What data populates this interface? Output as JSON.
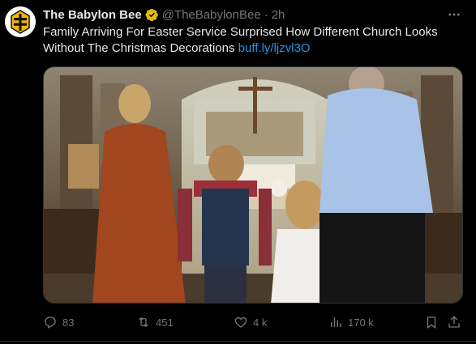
{
  "tweet": {
    "author_name": "The Babylon Bee",
    "author_handle": "@TheBabylonBee",
    "separator": "·",
    "time": "2h",
    "text": "Family Arriving For Easter Service Surprised How Different Church Looks Without The Christmas Decorations",
    "link": "buff.ly/ljzvl3O",
    "icons": {
      "verified": "verified-badge-icon",
      "more": "more-options-icon"
    }
  },
  "actions": {
    "replies": "83",
    "reposts": "451",
    "likes": "4 k",
    "views": "170 k"
  },
  "colors": {
    "background": "#000000",
    "text": "#e7e9ea",
    "muted": "#71767b",
    "link": "#1d9bf0",
    "verified_gold": "#e2b719"
  }
}
